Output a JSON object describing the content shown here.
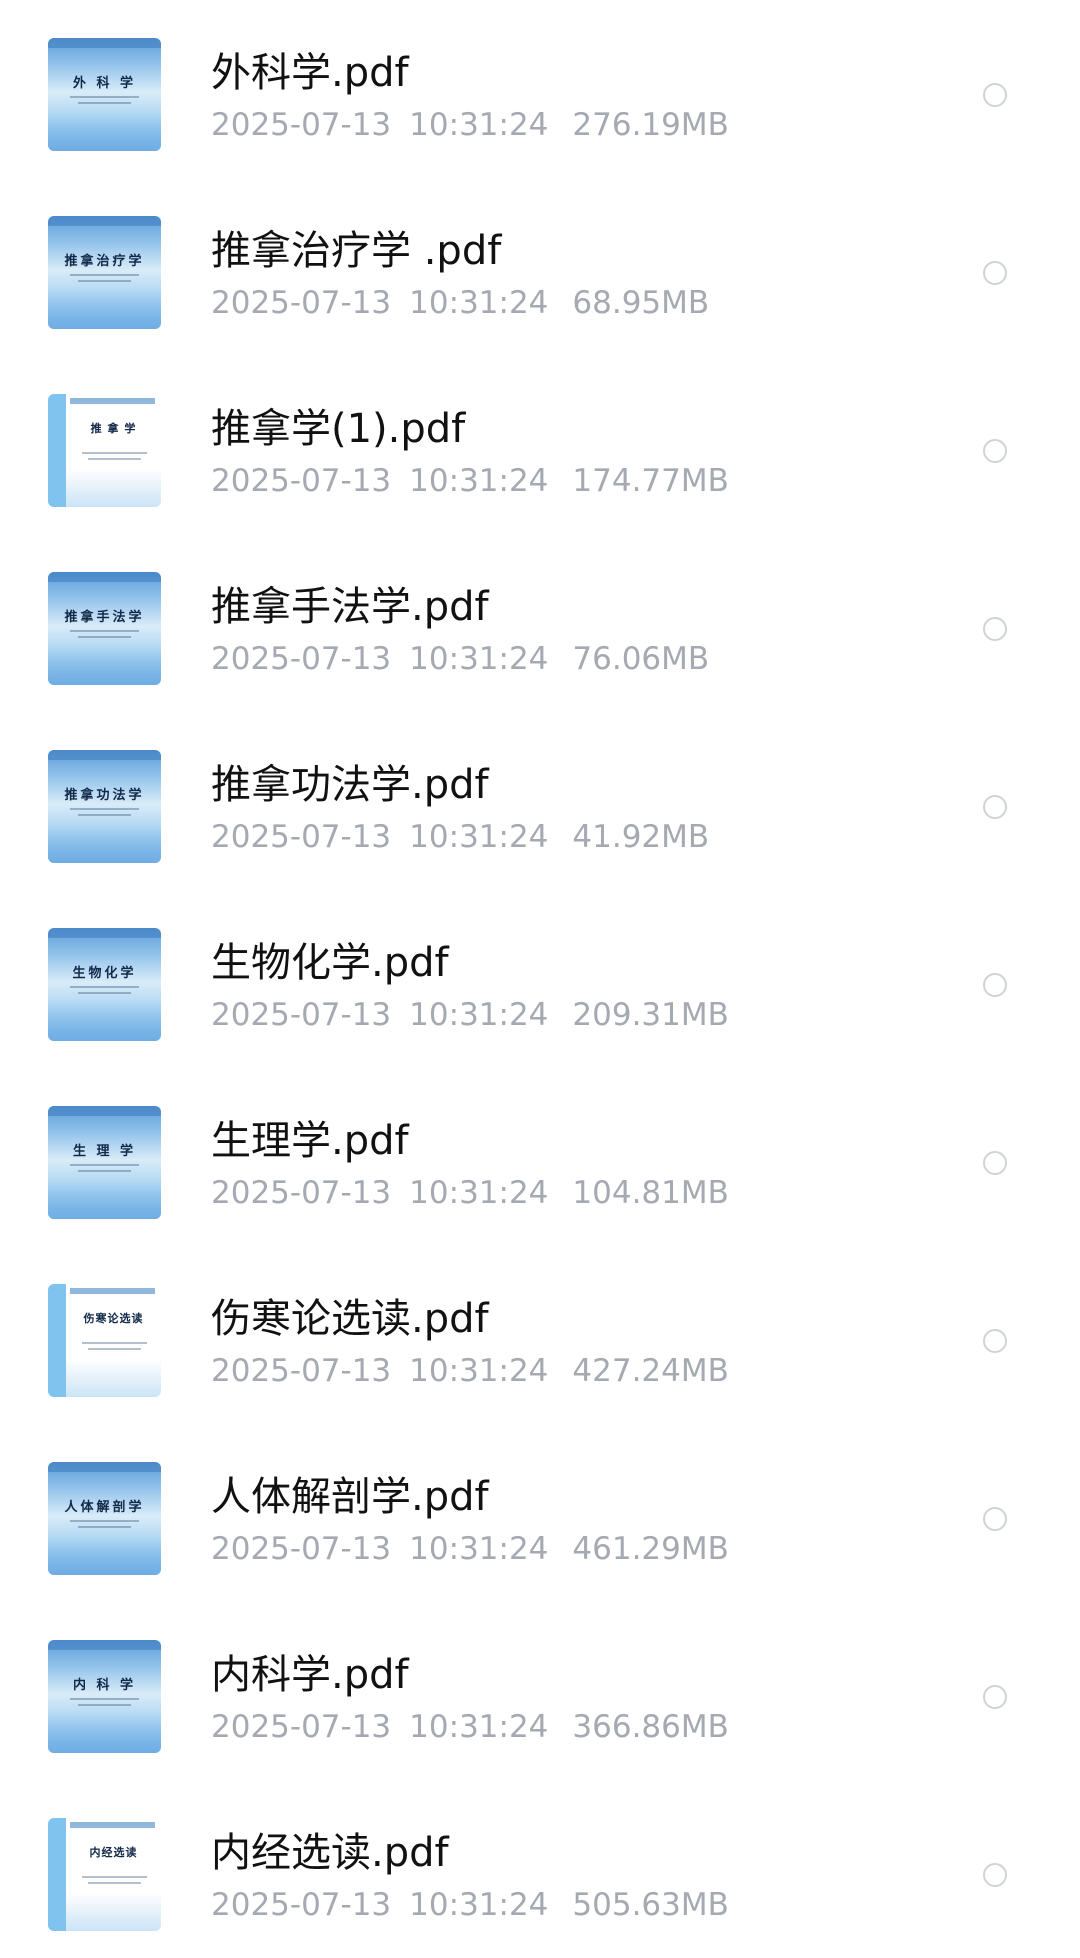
{
  "files": [
    {
      "name": "外科学.pdf",
      "date": "2025-07-13",
      "time": "10:31:24",
      "size": "276.19MB",
      "cover_title": "外 科 学",
      "cover_style": "a"
    },
    {
      "name": "推拿治疗学 .pdf",
      "date": "2025-07-13",
      "time": "10:31:24",
      "size": "68.95MB",
      "cover_title": "推拿治疗学",
      "cover_style": "a"
    },
    {
      "name": "推拿学(1).pdf",
      "date": "2025-07-13",
      "time": "10:31:24",
      "size": "174.77MB",
      "cover_title": "推 拿 学",
      "cover_style": "b"
    },
    {
      "name": "推拿手法学.pdf",
      "date": "2025-07-13",
      "time": "10:31:24",
      "size": "76.06MB",
      "cover_title": "推拿手法学",
      "cover_style": "a"
    },
    {
      "name": "推拿功法学.pdf",
      "date": "2025-07-13",
      "time": "10:31:24",
      "size": "41.92MB",
      "cover_title": "推拿功法学",
      "cover_style": "a"
    },
    {
      "name": "生物化学.pdf",
      "date": "2025-07-13",
      "time": "10:31:24",
      "size": "209.31MB",
      "cover_title": "生物化学",
      "cover_style": "a"
    },
    {
      "name": "生理学.pdf",
      "date": "2025-07-13",
      "time": "10:31:24",
      "size": "104.81MB",
      "cover_title": "生  理  学",
      "cover_style": "a"
    },
    {
      "name": "伤寒论选读.pdf",
      "date": "2025-07-13",
      "time": "10:31:24",
      "size": "427.24MB",
      "cover_title": "伤寒论选读",
      "cover_style": "b"
    },
    {
      "name": "人体解剖学.pdf",
      "date": "2025-07-13",
      "time": "10:31:24",
      "size": "461.29MB",
      "cover_title": "人体解剖学",
      "cover_style": "a"
    },
    {
      "name": "内科学.pdf",
      "date": "2025-07-13",
      "time": "10:31:24",
      "size": "366.86MB",
      "cover_title": "内 科 学",
      "cover_style": "a"
    },
    {
      "name": "内经选读.pdf",
      "date": "2025-07-13",
      "time": "10:31:24",
      "size": "505.63MB",
      "cover_title": "内经选读",
      "cover_style": "b"
    }
  ],
  "colors": {
    "name_text": "#111111",
    "meta_text": "#a5a9b1",
    "radio_border": "#cfd3d9"
  },
  "icons": {
    "thumbnail": "pdf-cover-thumbnail",
    "select": "radio-circle-icon"
  }
}
